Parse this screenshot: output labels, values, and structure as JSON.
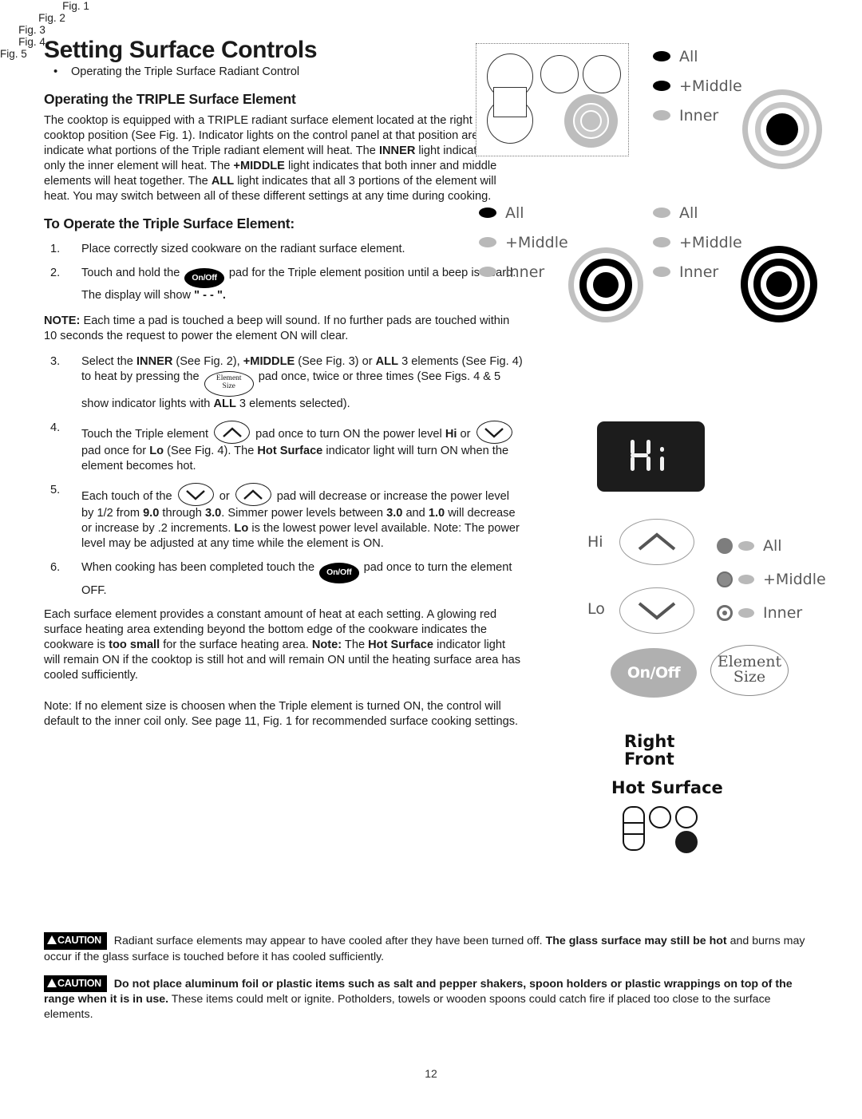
{
  "page": {
    "title": "Setting Surface Controls",
    "bullet": "Operating the Triple Surface Radiant Control",
    "page_number": "12"
  },
  "section_triple": {
    "heading": "Operating the TRIPLE Surface Element",
    "paragraph_parts": [
      {
        "text": "The cooktop is equipped with a TRIPLE radiant surface element located at the right front cooktop position (See Fig. 1). Indicator lights on the control panel at that position are used to indicate what portions of the Triple radiant element will heat. The ",
        "bold": false
      },
      {
        "text": "INNER",
        "bold": true
      },
      {
        "text": " light indicates that only the inner element will heat. The ",
        "bold": false
      },
      {
        "text": "+MIDDLE",
        "bold": true
      },
      {
        "text": " light indicates that both inner and middle elements will heat together. The ",
        "bold": false
      },
      {
        "text": "ALL",
        "bold": true
      },
      {
        "text": " light indicates that all 3 portions of the element will heat. You may switch between all of these different settings at any time during cooking.",
        "bold": false
      }
    ]
  },
  "section_operate": {
    "heading": "To Operate the Triple Surface Element:",
    "steps": [
      {
        "num": "1.",
        "parts": [
          {
            "text": "Place correctly sized cookware on the radiant surface element.",
            "bold": false
          }
        ]
      },
      {
        "num": "2.",
        "parts": [
          {
            "text": "Touch and hold the ",
            "bold": false
          },
          {
            "pad": "on-off",
            "label": "On/Off"
          },
          {
            "text": " pad for the Triple element position until a beep is heard. The display will show ",
            "bold": false
          },
          {
            "text": "\" - - \".",
            "bold": true
          }
        ]
      },
      {
        "num": "3.",
        "parts": [
          {
            "text": "Select the ",
            "bold": false
          },
          {
            "text": "INNER",
            "bold": true
          },
          {
            "text": " (See Fig. 2), ",
            "bold": false
          },
          {
            "text": "+MIDDLE",
            "bold": true
          },
          {
            "text": " (See Fig. 3) or ",
            "bold": false
          },
          {
            "text": "ALL",
            "bold": true
          },
          {
            "text": " 3 elements (See Fig. 4) to heat by pressing the ",
            "bold": false
          },
          {
            "pad": "element-size",
            "label_line1": "Element",
            "label_line2": "Size"
          },
          {
            "text": " pad once, twice or three times (See Figs. 4 & 5 show indicator lights with ",
            "bold": false
          },
          {
            "text": "ALL",
            "bold": true
          },
          {
            "text": " 3 elements selected).",
            "bold": false
          }
        ]
      },
      {
        "num": "4.",
        "parts": [
          {
            "text": "Touch the Triple element ",
            "bold": false
          },
          {
            "pad": "arrow-up"
          },
          {
            "text": " pad once to turn ON the power level ",
            "bold": false
          },
          {
            "text": "Hi",
            "bold": true
          },
          {
            "text": " or ",
            "bold": false
          },
          {
            "pad": "arrow-down"
          },
          {
            "text": " pad once for ",
            "bold": false
          },
          {
            "text": "Lo",
            "bold": true
          },
          {
            "text": " (See Fig. 4). The ",
            "bold": false
          },
          {
            "text": "Hot Surface",
            "bold": true
          },
          {
            "text": " indicator light will turn ON when the element becomes hot.",
            "bold": false
          }
        ]
      },
      {
        "num": "5.",
        "parts": [
          {
            "text": "Each touch of the ",
            "bold": false
          },
          {
            "pad": "arrow-down"
          },
          {
            "text": " or ",
            "bold": false
          },
          {
            "pad": "arrow-up"
          },
          {
            "text": " pad will decrease or increase the power level by 1/2 from ",
            "bold": false
          },
          {
            "text": "9.0",
            "bold": true
          },
          {
            "text": " through ",
            "bold": false
          },
          {
            "text": "3.0",
            "bold": true
          },
          {
            "text": ". Simmer power levels between ",
            "bold": false
          },
          {
            "text": "3.0",
            "bold": true
          },
          {
            "text": " and ",
            "bold": false
          },
          {
            "text": "1.0",
            "bold": true
          },
          {
            "text": " will decrease or increase by .2 increments. ",
            "bold": false
          },
          {
            "text": "Lo",
            "bold": true
          },
          {
            "text": " is the lowest power level available. Note: The power level may be adjusted at any time while the element is ON.",
            "bold": false
          }
        ]
      },
      {
        "num": "6.",
        "parts": [
          {
            "text": "When cooking has been completed touch the ",
            "bold": false
          },
          {
            "pad": "on-off",
            "label": "On/Off"
          },
          {
            "text": " pad once to turn the element OFF.",
            "bold": false
          }
        ]
      }
    ],
    "note_beep": [
      {
        "text": "NOTE:",
        "bold": true
      },
      {
        "text": " Each time a pad is touched a beep will sound. If no further pads are touched within 10 seconds the request to power the element ON will clear.",
        "bold": false
      }
    ],
    "tail_paragraph": [
      {
        "text": "Each surface element provides a constant amount of heat at each setting. A glowing red surface heating area extending beyond the bottom edge of the cookware indicates the cookware is ",
        "bold": false
      },
      {
        "text": "too small",
        "bold": true
      },
      {
        "text": " for the surface heating area. ",
        "bold": false
      },
      {
        "text": "Note:",
        "bold": true
      },
      {
        "text": " The ",
        "bold": false
      },
      {
        "text": "Hot Surface",
        "bold": true
      },
      {
        "text": " indicator light will remain ON if the cooktop is still hot and will remain ON until the heating surface area has cooled sufficiently.",
        "bold": false
      }
    ],
    "final_note": [
      {
        "text": "Note: If no element size is choosen when the Triple element is turned ON, the control will default to the inner coil only. See page 11, Fig. 1 for recommended surface cooking settings.",
        "bold": false
      }
    ]
  },
  "cautions": [
    {
      "badge": "CAUTION",
      "parts": [
        {
          "text": " Radiant surface elements may appear to have cooled after they have been turned off. ",
          "bold": false
        },
        {
          "text": "The glass surface may still be hot",
          "bold": true
        },
        {
          "text": " and burns may occur if the glass surface is touched before it has cooled sufficiently.",
          "bold": false
        }
      ]
    },
    {
      "badge": "CAUTION",
      "parts": [
        {
          "text": " ",
          "bold": false
        },
        {
          "text": "Do not place aluminum foil or plastic items such as salt and pepper shakers, spoon holders or plastic wrappings on top of the range when it is in use.",
          "bold": true
        },
        {
          "text": " These items could melt or ignite. Potholders, towels or wooden spoons could catch fire if placed too close to the surface elements.",
          "bold": false
        }
      ]
    }
  ],
  "figures": {
    "fig1": {
      "label": "Fig. 1",
      "caption": "cooktop layout with triple element at right front"
    },
    "fig2": {
      "label": "Fig. 2",
      "indicators": [
        {
          "name": "All",
          "state": "on"
        },
        {
          "name": "+Middle",
          "state": "on"
        },
        {
          "name": "Inner",
          "state": "off"
        }
      ],
      "element_rings": {
        "inner": "on",
        "middle": "off",
        "outer": "off"
      }
    },
    "fig3": {
      "label": "Fig. 3",
      "indicators": [
        {
          "name": "All",
          "state": "on"
        },
        {
          "name": "+Middle",
          "state": "off"
        },
        {
          "name": "Inner",
          "state": "off"
        }
      ],
      "element_rings": {
        "inner": "on",
        "middle": "on",
        "outer": "off"
      }
    },
    "fig4": {
      "label": "Fig. 4",
      "indicators": [
        {
          "name": "All",
          "state": "off"
        },
        {
          "name": "+Middle",
          "state": "off"
        },
        {
          "name": "Inner",
          "state": "off"
        }
      ],
      "element_rings": {
        "inner": "on",
        "middle": "on",
        "outer": "on"
      }
    },
    "fig5": {
      "label": "Fig. 5",
      "display_value": "Hi",
      "pad_hi_label": "Hi",
      "pad_lo_label": "Lo",
      "onoff_label": "On/Off",
      "elementsize_line1": "Element",
      "elementsize_line2": "Size",
      "indicators": [
        {
          "name": "All"
        },
        {
          "name": "+Middle"
        },
        {
          "name": "Inner"
        }
      ],
      "position_line1": "Right",
      "position_line2": "Front",
      "hot_surface_label": "Hot Surface"
    }
  }
}
